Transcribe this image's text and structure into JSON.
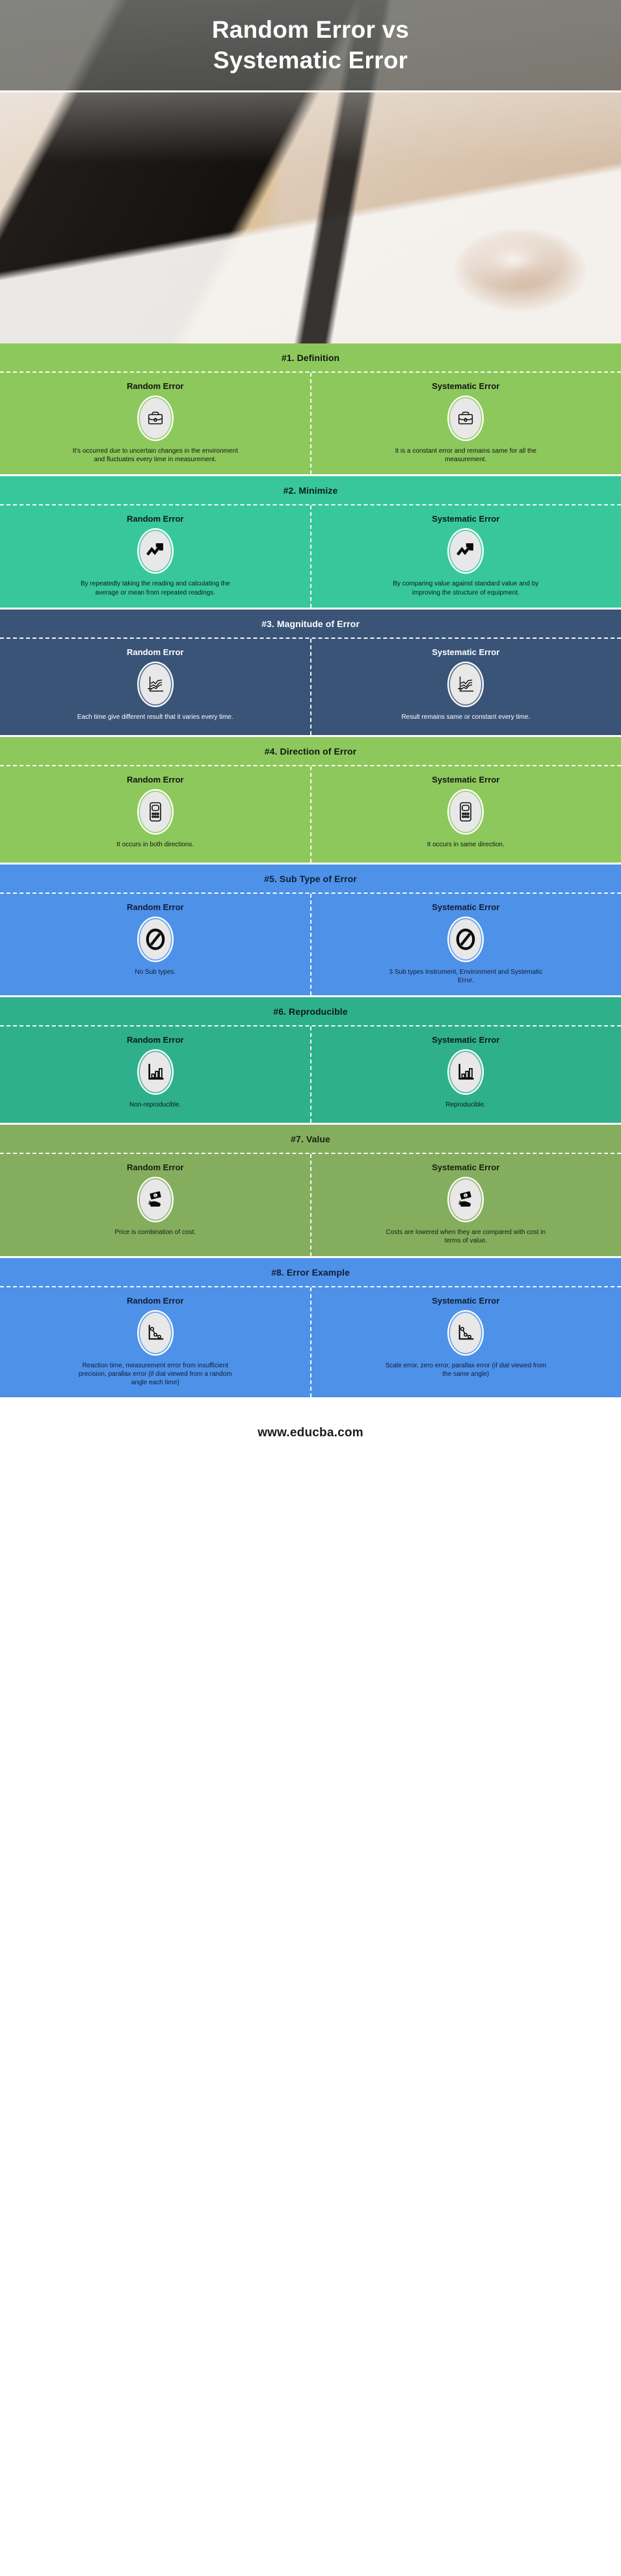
{
  "hero": {
    "title_line1": "Random Error vs",
    "title_line2": "Systematic Error",
    "photo_alt": "desk-with-imac-keyboard-mouse-and-pen-photo"
  },
  "column_labels": {
    "random": "Random Error",
    "systematic": "Systematic Error"
  },
  "colors": {
    "green": "#8dc85c",
    "teal": "#37c79b",
    "navy": "#3a5478",
    "blue": "#4e91e8",
    "emerald": "#2eb08c",
    "olive": "#85ad5e",
    "badge_fill": "#e8e8e8",
    "divider": "#ffffff"
  },
  "sections": [
    {
      "title": "#1. Definition",
      "theme": "green",
      "icon": "briefcase-icon",
      "random": {
        "label": "Random Error",
        "text": "It's occurred due to uncertain changes in the environment and fluctuates every time in measurement."
      },
      "systematic": {
        "label": "Systematic Error",
        "text": "It is a constant error and remains same for all the measurement."
      }
    },
    {
      "title": "#2. Minimize",
      "theme": "teal",
      "icon": "trend-arrow-up-icon",
      "random": {
        "label": "Random Error",
        "text": "By repeatedly taking the reading and calculating the average or mean from repeated readings."
      },
      "systematic": {
        "label": "Systematic Error",
        "text": "By comparing value against standard value and by improving the structure of equipment."
      }
    },
    {
      "title": "#3. Magnitude of Error",
      "theme": "navy",
      "icon": "line-graph-icon",
      "random": {
        "label": "Random Error",
        "text": "Each time give different result that it varies every time."
      },
      "systematic": {
        "label": "Systematic Error",
        "text": "Result remains same or constant every time."
      }
    },
    {
      "title": "#4. Direction of Error",
      "theme": "green",
      "icon": "calculator-icon",
      "random": {
        "label": "Random Error",
        "text": "It occurs in both directions."
      },
      "systematic": {
        "label": "Systematic Error",
        "text": "It occurs in same direction."
      }
    },
    {
      "title": "#5. Sub Type of Error",
      "theme": "blue",
      "icon": "prohibited-icon",
      "random": {
        "label": "Random Error",
        "text": "No Sub types."
      },
      "systematic": {
        "label": "Systematic Error",
        "text": "3 Sub types Instrument, Environment and Systematic Error."
      }
    },
    {
      "title": "#6. Reproducible",
      "theme": "emerald",
      "icon": "bar-chart-icon",
      "random": {
        "label": "Random Error",
        "text": "Non-reproducible."
      },
      "systematic": {
        "label": "Systematic Error",
        "text": "Reproducible."
      }
    },
    {
      "title": "#7. Value",
      "theme": "olive",
      "icon": "cash-in-hand-icon",
      "random": {
        "label": "Random Error",
        "text": "Price is combination of cost."
      },
      "systematic": {
        "label": "Systematic Error",
        "text": "Costs are lowered when they are compared with cost in terms of value."
      }
    },
    {
      "title": "#8. Error Example",
      "theme": "blue",
      "icon": "declining-scatter-graph-icon",
      "random": {
        "label": "Random Error",
        "text": "Reaction time, measurement error from insufficient precision, parallax error (if dial viewed from a random angle each time)"
      },
      "systematic": {
        "label": "Systematic Error",
        "text": "Scale error, zero error, parallax error (if dial viewed from the same angle)"
      }
    }
  ],
  "footer": {
    "url": "www.educba.com"
  }
}
